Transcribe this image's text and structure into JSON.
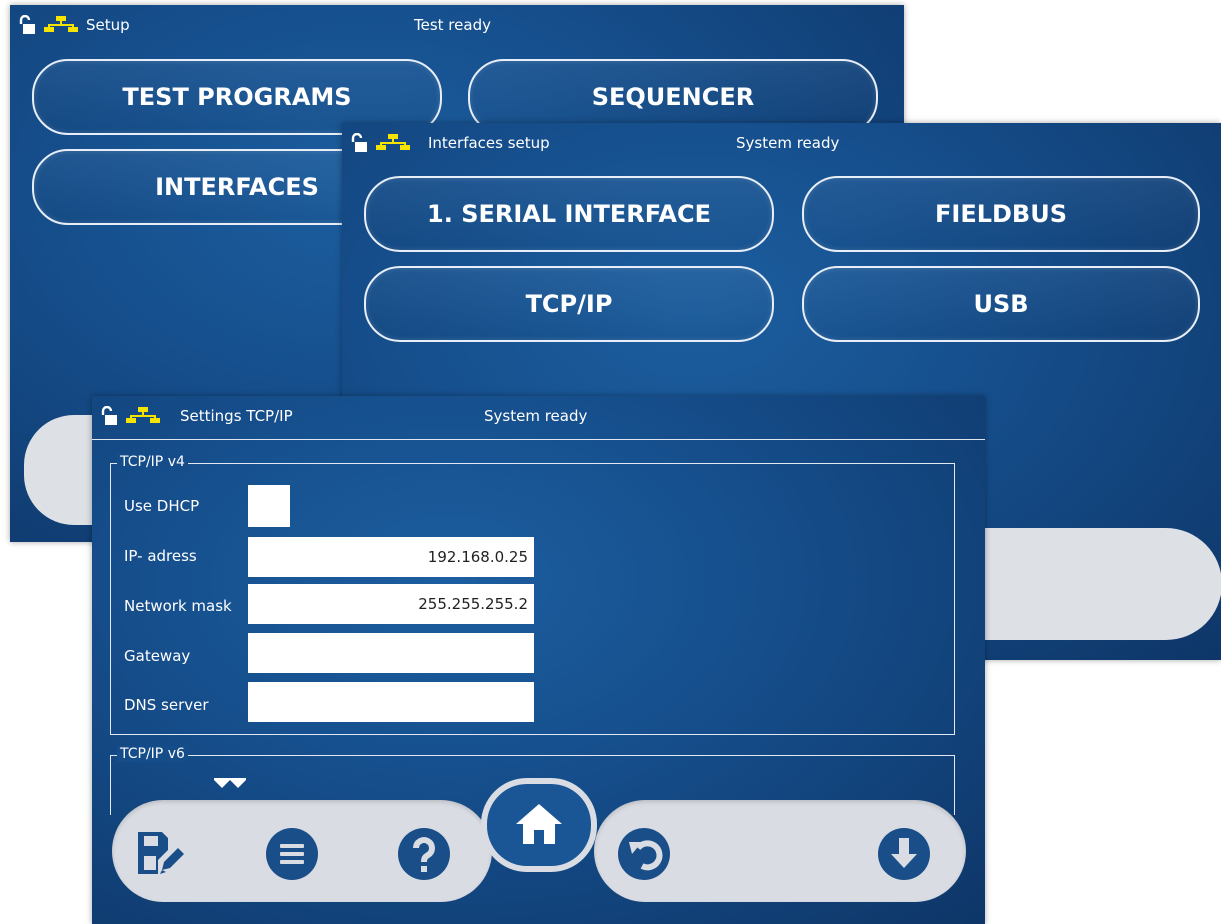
{
  "colors": {
    "panel_bg": "#154d8a",
    "panel_dark": "#0e3668",
    "network_icon": "#f5e400",
    "toolbar_bg": "#d9dde3",
    "icon_fg": "#1a4e89"
  },
  "setup_screen": {
    "title": "Setup",
    "status": "Test ready",
    "buttons": {
      "test_programs": "TEST PROGRAMS",
      "sequencer": "SEQUENCER",
      "interfaces": "INTERFACES"
    }
  },
  "interfaces_screen": {
    "title": "Interfaces setup",
    "status": "System ready",
    "buttons": {
      "serial": "1. SERIAL INTERFACE",
      "fieldbus": "FIELDBUS",
      "tcpip": "TCP/IP",
      "usb": "USB"
    }
  },
  "tcpip_screen": {
    "title": "Settings TCP/IP",
    "status": "System ready",
    "v4_group": {
      "label": "TCP/IP v4",
      "dhcp_label": "Use DHCP",
      "ip_label": "IP- adress",
      "ip_value": "192.168.0.25",
      "mask_label": "Network mask",
      "mask_value": "255.255.255.2",
      "gateway_label": "Gateway",
      "gateway_value": "",
      "dns_label": "DNS server",
      "dns_value": ""
    },
    "v6_group": {
      "label": "TCP/IP v6"
    },
    "toolbar": {
      "icons": [
        "save-edit-icon",
        "menu-icon",
        "help-icon",
        "home-icon",
        "undo-icon",
        "scroll-down-icon"
      ]
    }
  }
}
